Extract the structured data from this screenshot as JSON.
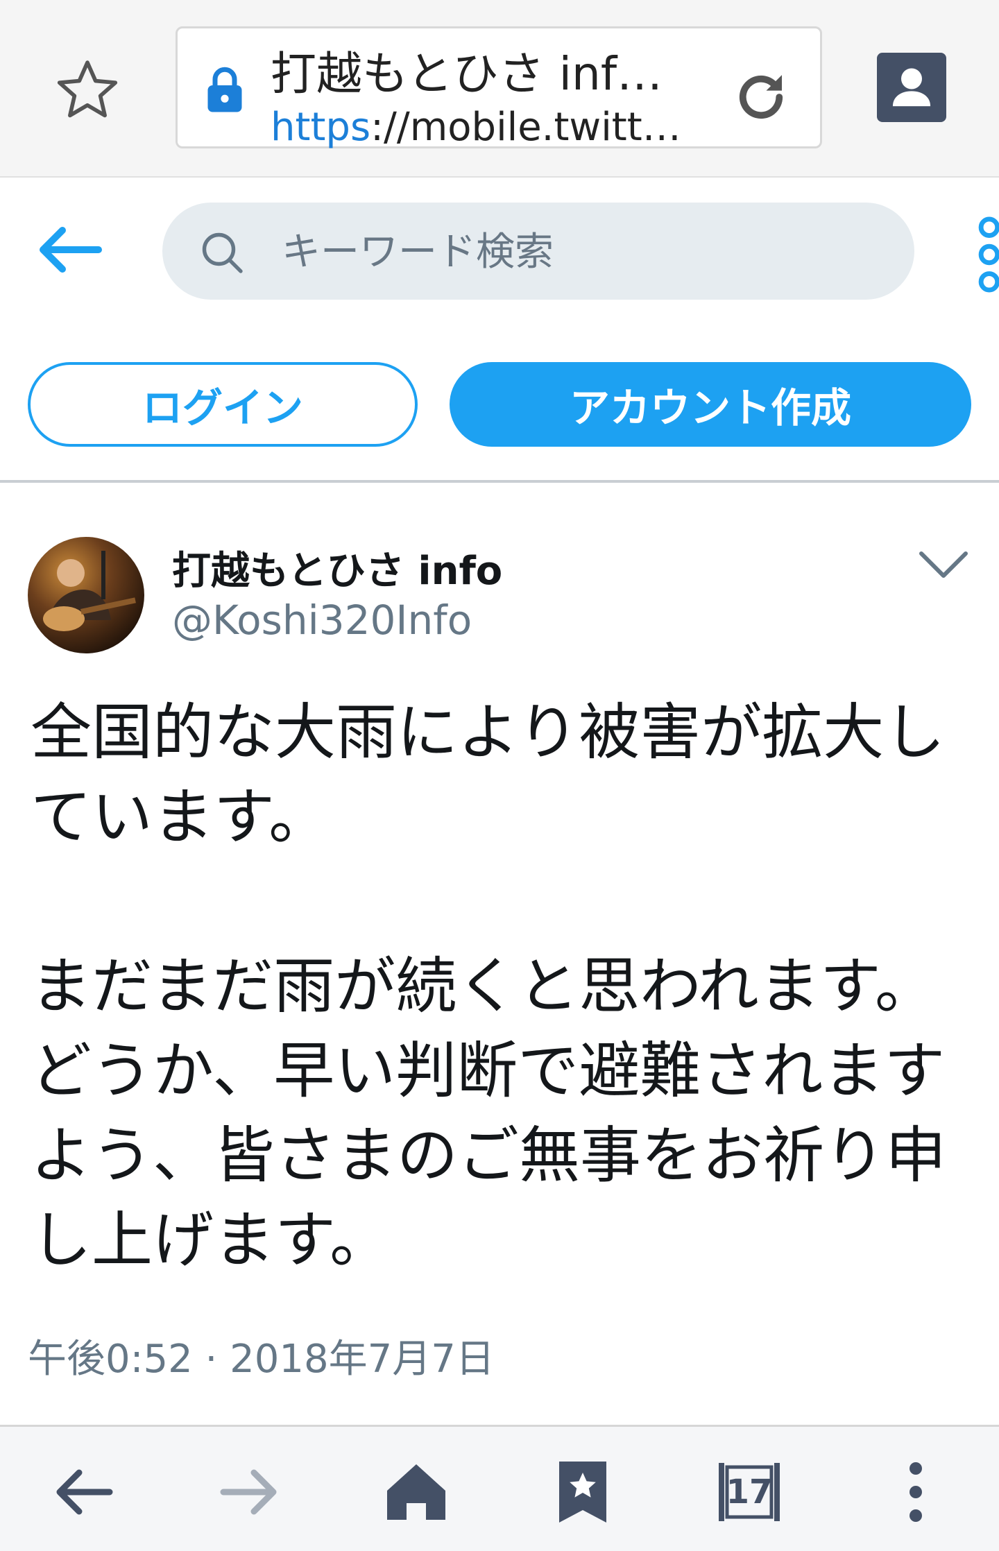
{
  "browser": {
    "page_title": "打越もとひさ inf…",
    "url_scheme": "https",
    "url_rest": "://mobile.twitt…",
    "tab_count": "17"
  },
  "header": {
    "search_placeholder": "キーワード検索"
  },
  "auth": {
    "login_label": "ログイン",
    "signup_label": "アカウント作成"
  },
  "tweet": {
    "display_name": "打越もとひさ info",
    "handle": "@Koshi320Info",
    "text_line_1": "全国的な大雨により被害が拡大しています。",
    "text_line_2": "まだまだ雨が続くと思われます。どうか、早い判断で避難されますよう、皆さまのご無事をお祈り申し上げます。",
    "timestamp": "午後0:52 · 2018年7月7日"
  },
  "colors": {
    "accent": "#1da1f2",
    "icon_dark": "#445066",
    "muted_text": "#657786"
  }
}
